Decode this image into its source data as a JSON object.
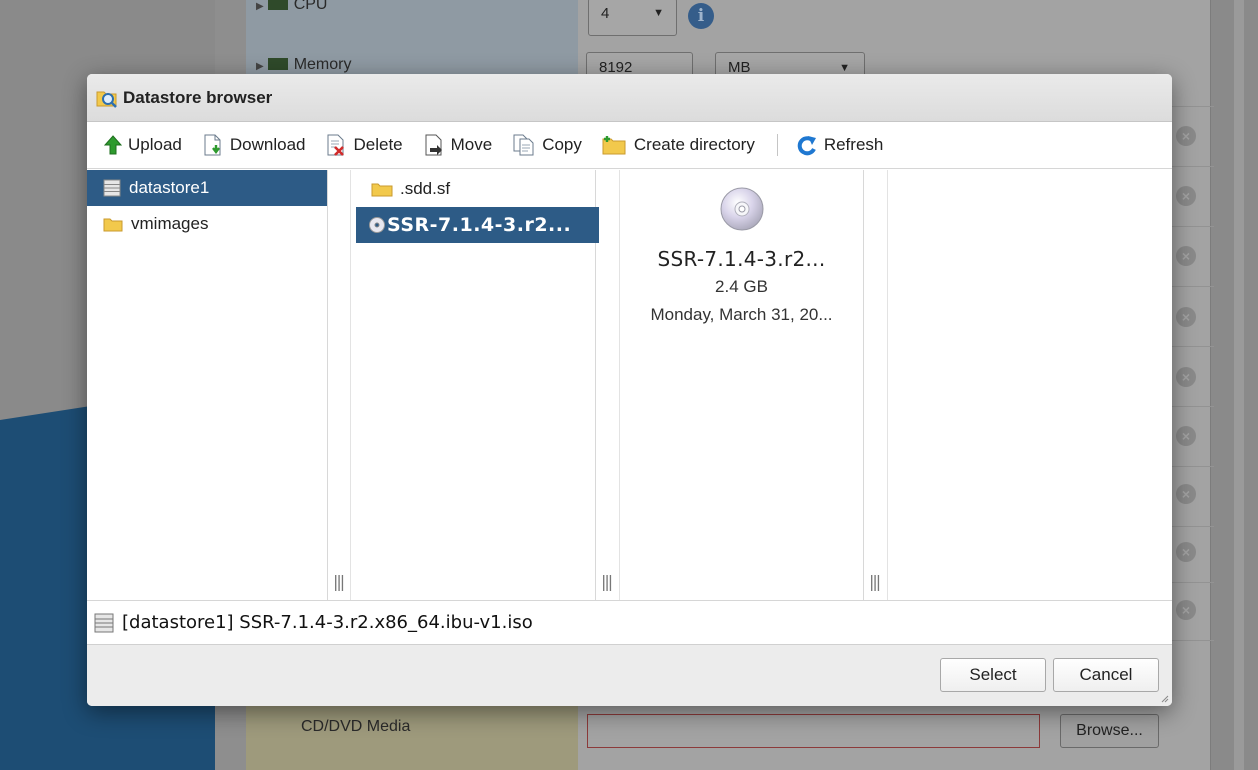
{
  "background": {
    "cpu_label": "CPU",
    "cpu_value": "4",
    "memory_label": "Memory",
    "memory_value": "8192",
    "memory_unit": "MB",
    "cd_label": "CD/DVD Media",
    "browse_label": "Browse...",
    "info_glyph": "i"
  },
  "dialog": {
    "title": "Datastore browser",
    "toolbar": {
      "upload": "Upload",
      "download": "Download",
      "delete": "Delete",
      "move": "Move",
      "copy": "Copy",
      "create_directory": "Create directory",
      "refresh": "Refresh"
    },
    "datastores": [
      {
        "label": "datastore1",
        "selected": true
      },
      {
        "label": "vmimages",
        "selected": false
      }
    ],
    "files": [
      {
        "label": ".sdd.sf",
        "type": "folder",
        "selected": false
      },
      {
        "label": "SSR-7.1.4-3.r2...",
        "type": "iso",
        "selected": true
      }
    ],
    "detail": {
      "name": "SSR-7.1.4-3.r2...",
      "size": "2.4 GB",
      "date": "Monday, March 31, 20..."
    },
    "path": "[datastore1] SSR-7.1.4-3.r2.x86_64.ibu-v1.iso",
    "select_label": "Select",
    "cancel_label": "Cancel"
  },
  "colors": {
    "selection": "#2d5b86",
    "refresh_blue": "#1f78d1",
    "upload_green": "#2e9a2e",
    "folder_yellow": "#f2c94c"
  }
}
